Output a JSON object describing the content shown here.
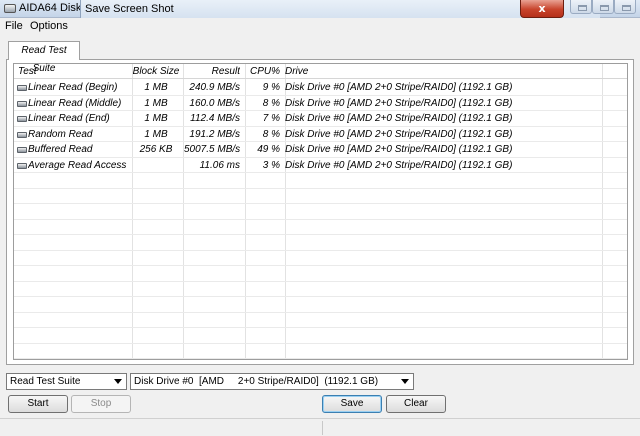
{
  "window": {
    "app_title": "AIDA64 Disk",
    "overlay_title": "Save Screen Shot",
    "close_glyph": "x"
  },
  "menu": [
    "File",
    "Options"
  ],
  "tab": {
    "label": "Read Test Suite"
  },
  "table": {
    "headers": [
      "Test",
      "Block Size",
      "Result",
      "CPU%",
      "Drive"
    ],
    "rows": [
      [
        "Linear Read (Begin)",
        "1 MB",
        "240.9 MB/s",
        "9 %",
        "Disk Drive #0  [AMD     2+0 Stripe/RAID0]  (1192.1 GB)"
      ],
      [
        "Linear Read (Middle)",
        "1 MB",
        "160.0 MB/s",
        "8 %",
        "Disk Drive #0  [AMD     2+0 Stripe/RAID0]  (1192.1 GB)"
      ],
      [
        "Linear Read (End)",
        "1 MB",
        "112.4 MB/s",
        "7 %",
        "Disk Drive #0  [AMD     2+0 Stripe/RAID0]  (1192.1 GB)"
      ],
      [
        "Random Read",
        "1 MB",
        "191.2 MB/s",
        "8 %",
        "Disk Drive #0  [AMD     2+0 Stripe/RAID0]  (1192.1 GB)"
      ],
      [
        "Buffered Read",
        "256 KB",
        "5007.5 MB/s",
        "49 %",
        "Disk Drive #0  [AMD     2+0 Stripe/RAID0]  (1192.1 GB)"
      ],
      [
        "Average Read Access",
        "",
        "11.06 ms",
        "3 %",
        "Disk Drive #0  [AMD     2+0 Stripe/RAID0]  (1192.1 GB)"
      ]
    ]
  },
  "controls": {
    "suite_select": "Read Test Suite",
    "drive_select": "Disk Drive #0  [AMD     2+0 Stripe/RAID0]  (1192.1 GB)",
    "start": "Start",
    "stop": "Stop",
    "save": "Save",
    "clear": "Clear"
  }
}
